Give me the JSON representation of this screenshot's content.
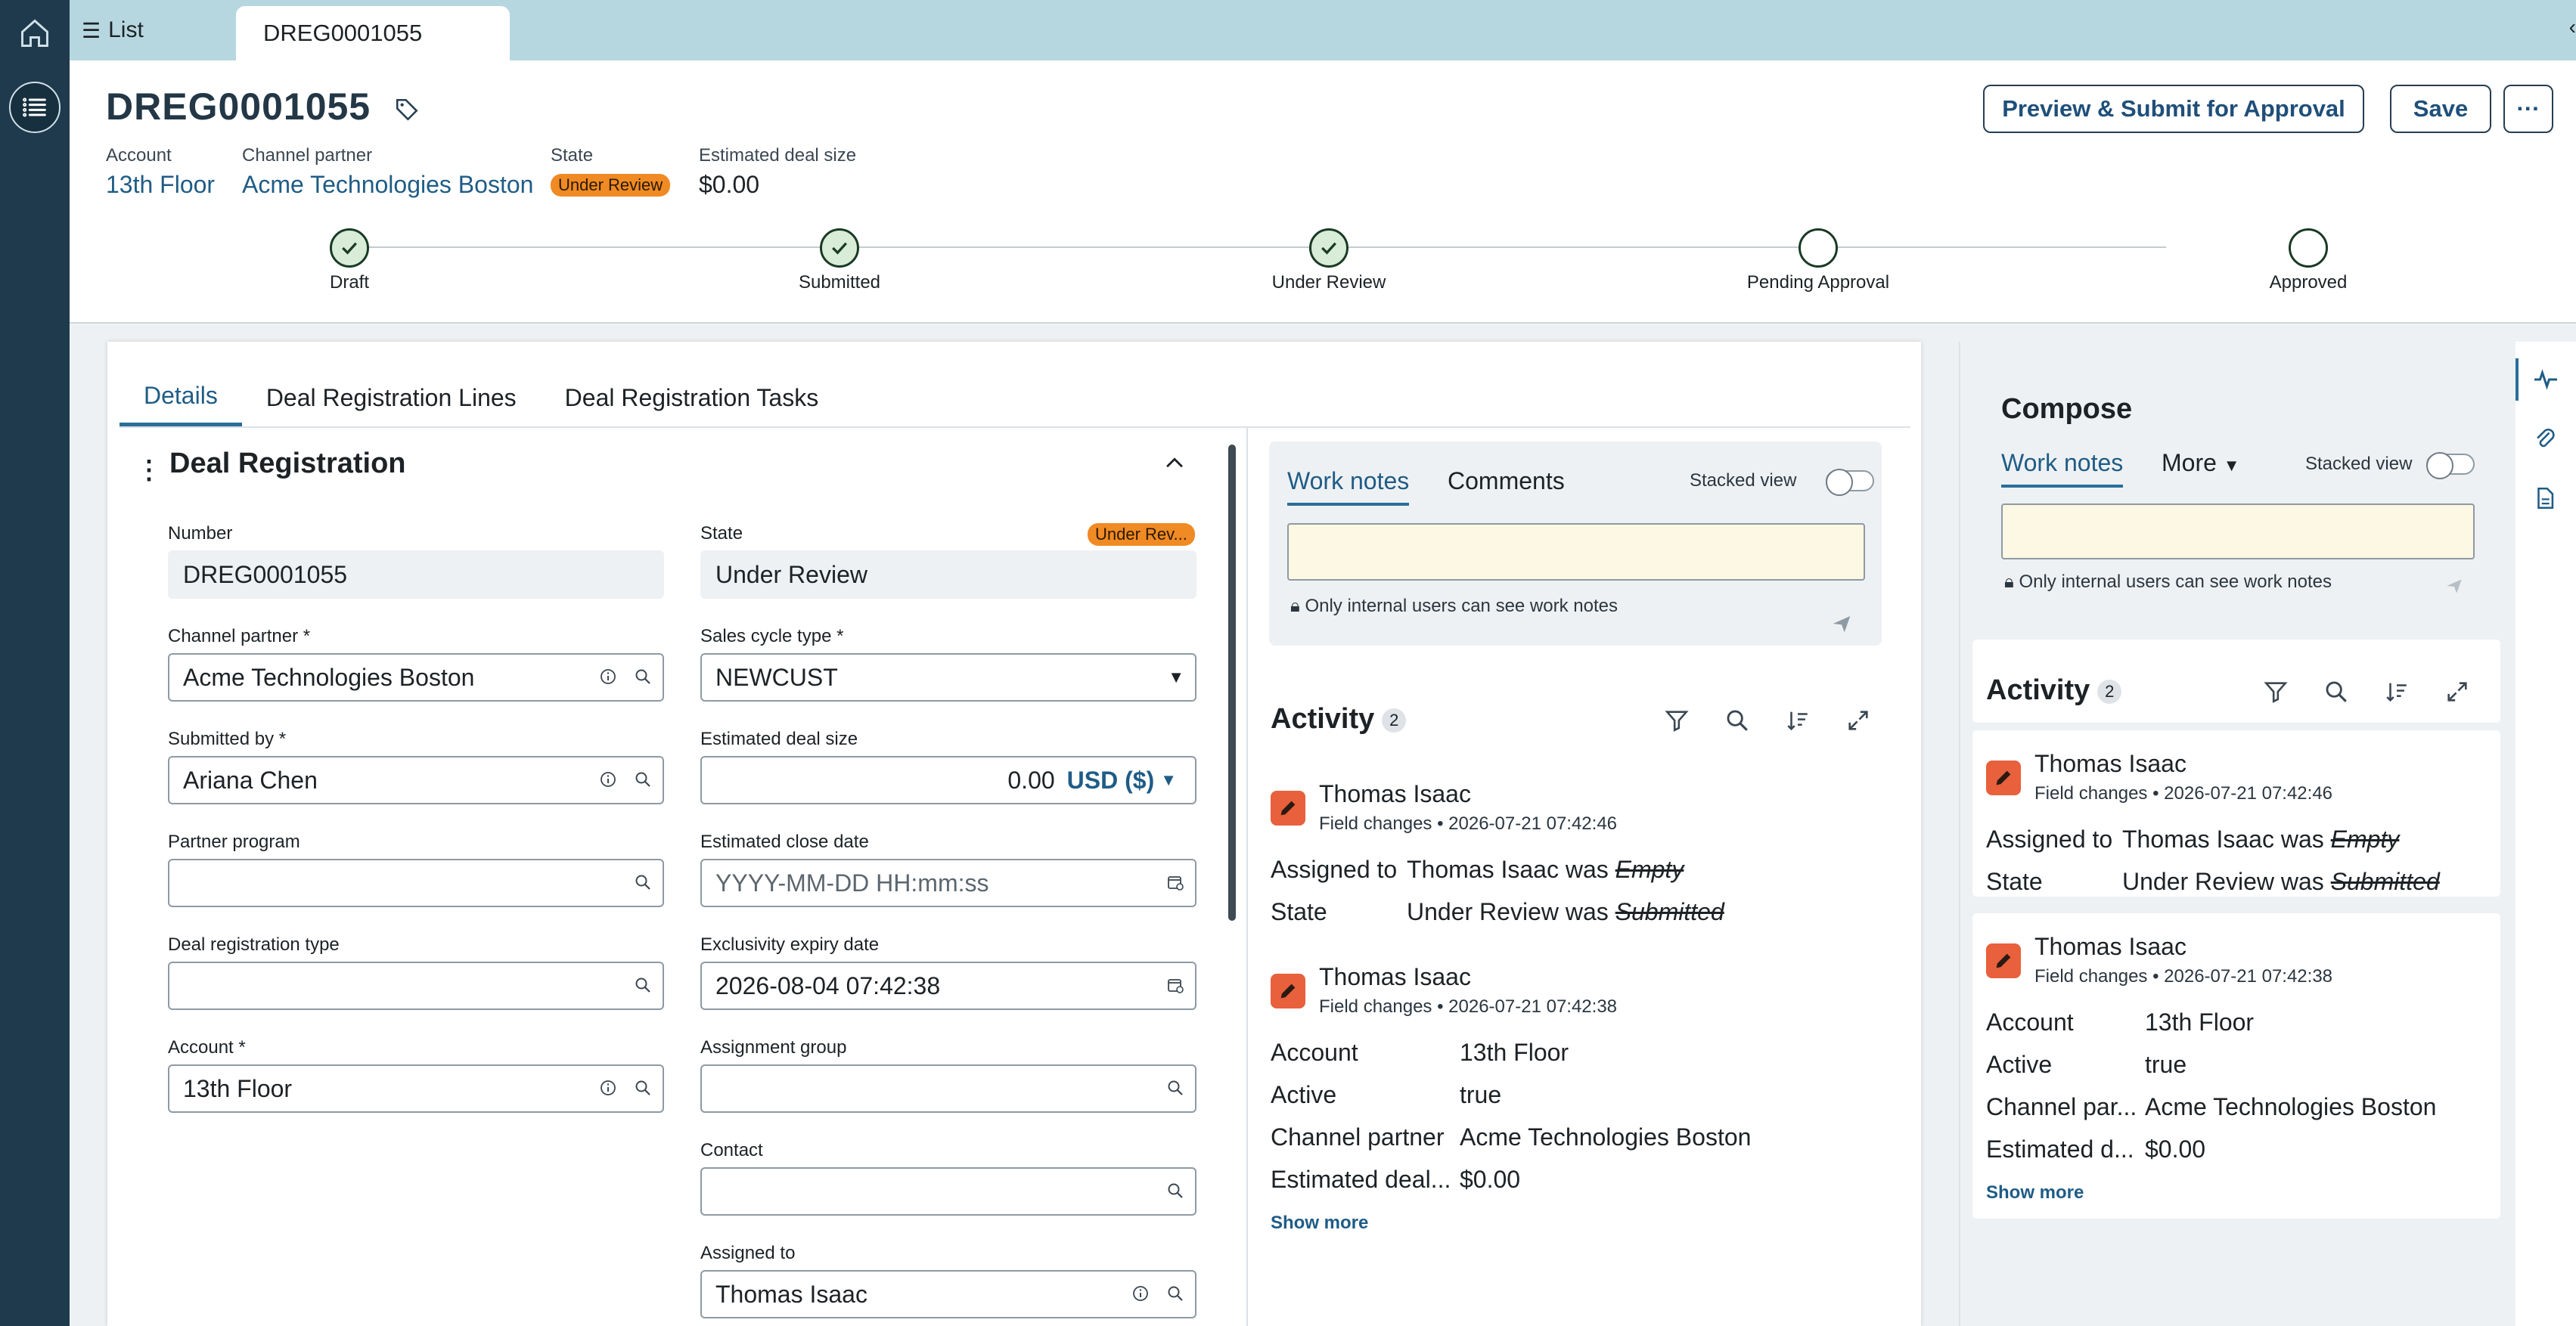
{
  "nav": {
    "list_tab": "List",
    "record_tab": "DREG0001055"
  },
  "header": {
    "title": "DREG0001055",
    "preview_button": "Preview & Submit for Approval",
    "save_button": "Save",
    "more_button": "···",
    "account_label": "Account",
    "account_value": "13th Floor",
    "partner_label": "Channel partner",
    "partner_value": "Acme Technologies Boston",
    "state_label": "State",
    "state_value": "Under Review",
    "deal_label": "Estimated deal size",
    "deal_value": "$0.00"
  },
  "stages": [
    "Draft",
    "Submitted",
    "Under Review",
    "Pending Approval",
    "Approved"
  ],
  "stages_done": [
    true,
    true,
    true,
    false,
    false
  ],
  "tabs": [
    "Details",
    "Deal Registration Lines",
    "Deal Registration Tasks"
  ],
  "form": {
    "section_title": "Deal Registration",
    "number_label": "Number",
    "number_value": "DREG0001055",
    "state_label": "State",
    "state_badge": "Under Rev...",
    "state_value": "Under Review",
    "partner_label": "Channel partner",
    "partner_value": "Acme Technologies Boston",
    "sales_label": "Sales cycle type",
    "sales_value": "NEWCUST",
    "submitted_label": "Submitted by",
    "submitted_value": "Ariana Chen",
    "deal_size_label": "Estimated deal size",
    "deal_size_value": "0.00",
    "currency": "USD ($)",
    "program_label": "Partner program",
    "close_label": "Estimated close date",
    "close_placeholder": "YYYY-MM-DD HH:mm:ss",
    "reg_type_label": "Deal registration type",
    "excl_label": "Exclusivity expiry date",
    "excl_value": "2026-08-04 07:42:38",
    "account_label": "Account",
    "account_value": "13th Floor",
    "group_label": "Assignment group",
    "contact_label": "Contact",
    "assigned_label": "Assigned to",
    "assigned_value": "Thomas Isaac",
    "required_mark": "*"
  },
  "activity_panel": {
    "work_notes_tab": "Work notes",
    "comments_tab": "Comments",
    "stacked": "Stacked view",
    "internal_note": "Only internal users can see work notes",
    "title": "Activity",
    "count": "2",
    "entries": [
      {
        "name": "Thomas Isaac",
        "sub": "Field changes • 2026-07-21 07:42:46",
        "rows": [
          {
            "k": "Assigned to",
            "v": "Thomas Isaac was ",
            "old": "Empty"
          },
          {
            "k": "State",
            "v": "Under Review was ",
            "old": "Submitted"
          }
        ]
      },
      {
        "name": "Thomas Isaac",
        "sub": "Field changes • 2026-07-21 07:42:38",
        "rows": [
          {
            "k": "Account",
            "v": "13th Floor"
          },
          {
            "k": "Active",
            "v": "true"
          },
          {
            "k": "Channel partner",
            "v": "Acme Technologies Boston"
          },
          {
            "k": "Estimated deal...",
            "v": "$0.00"
          }
        ]
      }
    ],
    "show_more": "Show more"
  },
  "side_panel": {
    "compose": "Compose",
    "work_notes_tab": "Work notes",
    "more_tab": "More",
    "stacked": "Stacked view",
    "internal_note": "Only internal users can see work notes",
    "title": "Activity",
    "count": "2",
    "entries": [
      {
        "name": "Thomas Isaac",
        "sub": "Field changes • 2026-07-21 07:42:46",
        "rows": [
          {
            "k": "Assigned to",
            "v": "Thomas Isaac was ",
            "old": "Empty"
          },
          {
            "k": "State",
            "v": "Under Review was ",
            "old": "Submitted"
          }
        ]
      },
      {
        "name": "Thomas Isaac",
        "sub": "Field changes • 2026-07-21 07:42:38",
        "rows": [
          {
            "k": "Account",
            "v": "13th Floor"
          },
          {
            "k": "Active",
            "v": "true"
          },
          {
            "k": "Channel par...",
            "v": "Acme Technologies Boston"
          },
          {
            "k": "Estimated d...",
            "v": "$0.00"
          }
        ]
      }
    ],
    "show_more": "Show more"
  },
  "colors": {
    "accent": "#1f5c86",
    "badge": "#f08a24",
    "rail": "#1f3a4d",
    "topbar": "#b7d7e0"
  }
}
